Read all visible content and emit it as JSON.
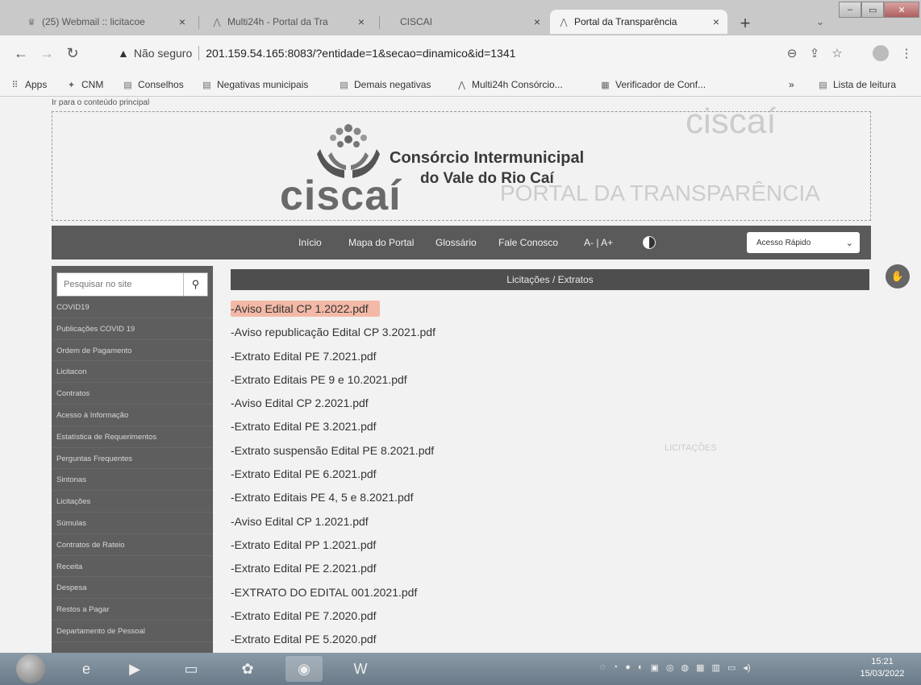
{
  "browser": {
    "tabs": [
      {
        "label": "(25) Webmail :: licitacoe",
        "icon": "crown-icon"
      },
      {
        "label": "Multi24h - Portal da Tra",
        "icon": "multi24h-icon"
      },
      {
        "label": "CISCAI",
        "icon": ""
      },
      {
        "label": "Portal da Transparência",
        "icon": "multi24h-icon"
      }
    ],
    "new_tab": "+",
    "address": {
      "security": "Não seguro",
      "url": "201.159.54.165:8083/?entidade=1&secao=dinamico&id=1341"
    },
    "bookmarks": [
      "Apps",
      "CNM",
      "Conselhos",
      "Negativas municipais",
      "Demais negativas",
      "Multi24h Consórcio...",
      "Verificador de Conf..."
    ],
    "bookmarks_overflow": "»",
    "reading_list": "Lista de leitura"
  },
  "page": {
    "skip_link": "Ir para o conteúdo principal",
    "logo_word": "ciscaí",
    "org_line1": "Consórcio Intermunicipal",
    "org_line2": "do Vale do Rio Caí",
    "nav": [
      "Início",
      "Mapa do Portal",
      "Glossário",
      "Fale Conosco",
      "A- | A+"
    ],
    "quick_access": "Acesso Rápido",
    "search_placeholder": "Pesquisar no site",
    "sidebar": [
      "COVID19",
      "Publicações COVID 19",
      "Ordem de Pagamento",
      "Licitacon",
      "Contratos",
      "Acesso à Informação",
      "Estatística de Requerimentos",
      "Perguntas Frequentes",
      "Sintonas",
      "Licitações",
      "Súmulas",
      "Contratos de Rateio",
      "Receita",
      "Despesa",
      "Restos a Pagar",
      "Departamento de Pessoal"
    ],
    "section_title": "Licitações / Extratos",
    "files": [
      "-Aviso Edital CP 1.2022.pdf",
      "-Aviso republicação Edital CP 3.2021.pdf",
      "-Extrato Edital PE 7.2021.pdf",
      "-Extrato Editais PE 9 e 10.2021.pdf",
      "-Aviso Edital CP 2.2021.pdf",
      "-Extrato Edital PE 3.2021.pdf",
      "-Extrato suspensão Edital PE 8.2021.pdf",
      "-Extrato Edital PE 6.2021.pdf",
      "-Extrato Editais PE 4, 5 e 8.2021.pdf",
      "-Aviso Edital CP 1.2021.pdf",
      "-Extrato Edital PP 1.2021.pdf",
      "-Extrato Edital PE 2.2021.pdf",
      "-EXTRATO DO EDITAL 001.2021.pdf",
      "-Extrato Edital PE 7.2020.pdf",
      "-Extrato Edital PE 5.2020.pdf"
    ],
    "ghost_title": "PORTAL DA TRANSPARÊNCIA",
    "ghost_logo": "ciscaí",
    "ghost_section": "LICITAÇÕES"
  },
  "taskbar": {
    "time": "15:21",
    "date": "15/03/2022"
  }
}
